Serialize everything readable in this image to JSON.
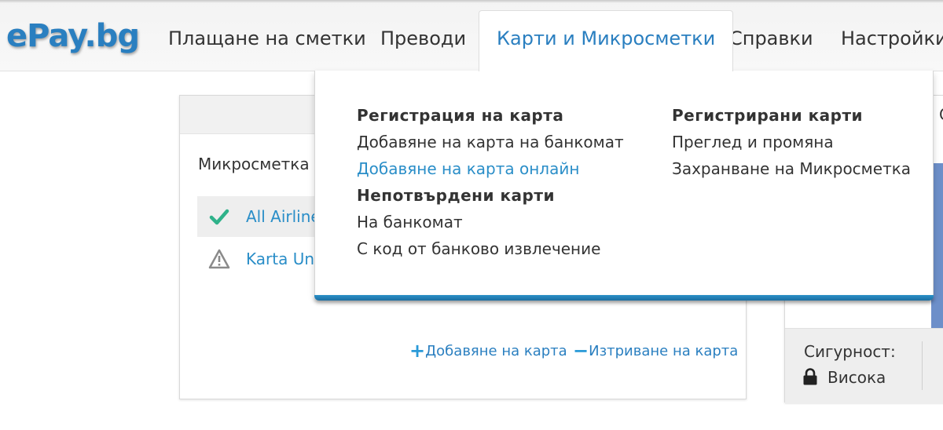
{
  "logo": "ePay.bg",
  "nav": {
    "items": [
      {
        "label": "Плащане на сметки"
      },
      {
        "label": "Преводи"
      },
      {
        "label": "Карти и Микросметки"
      },
      {
        "label": "Справки"
      },
      {
        "label": "Настройки"
      }
    ],
    "active_index": 2
  },
  "dropdown": {
    "col1": {
      "group1_title": "Регистрация на карта",
      "group1_links": [
        "Добавяне на карта на банкомат",
        "Добавяне на карта онлайн"
      ],
      "group2_title": "Непотвърдени карти",
      "group2_links": [
        "На банкомат",
        "С код от банково извлечение"
      ]
    },
    "col2": {
      "group1_title": "Регистрирани карти",
      "group1_links": [
        "Преглед и промяна",
        "Захранване на Микросметка"
      ]
    }
  },
  "card": {
    "subtitle": "Микросметка",
    "rows": [
      {
        "label": "All Airline",
        "icon": "check-icon",
        "status_color": "#2fb28a"
      },
      {
        "label": "Karta Uni",
        "icon": "warning-icon",
        "status_color": "#8a8a8a"
      }
    ],
    "add_label": "Добавяне на карта",
    "remove_label": "Изтриване на карта"
  },
  "security": {
    "label": "Сигурност:",
    "value": "Висока",
    "side_letter": "С"
  },
  "colors": {
    "accent": "#2a7fc0",
    "link": "#2a8ec8",
    "check": "#2fb28a"
  }
}
